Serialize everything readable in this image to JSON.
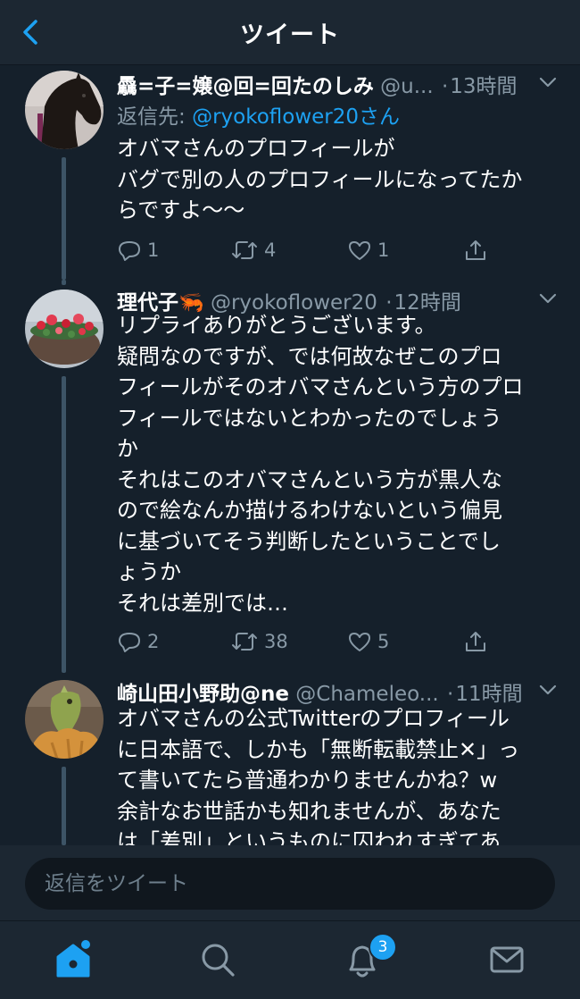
{
  "header": {
    "title": "ツイート",
    "back_icon": "chevron-left-icon"
  },
  "tweets": [
    {
      "name": "驫=子=嬢@回=回たのしみ",
      "handle": "@u...",
      "time": "13時間",
      "replying_prefix": "返信先: ",
      "replying_to": "@ryokoflower20さん",
      "text": "オバマさんのプロフィールが\nバグで別の人のプロフィールになってたか\nらですよ〜〜",
      "replies": "1",
      "retweets": "4",
      "likes": "1"
    },
    {
      "name": "理代子",
      "name_emoji": "🦐",
      "handle": "@ryokoflower20",
      "time": "12時間",
      "text": "リプライありがとうございます。\n疑問なのですが、では何故なぜこのプロ\nフィールがそのオバマさんという方のプロ\nフィールではないとわかったのでしょう\nか\nそれはこのオバマさんという方が黒人な\nので絵なんか描けるわけないという偏見\nに基づいてそう判断したということでし\nょうか\nそれは差別では…",
      "replies": "2",
      "retweets": "38",
      "likes": "5"
    },
    {
      "name": "崎山田小野助@ne",
      "handle": "@Chameleo...",
      "time": "11時間",
      "text": "オバマさんの公式Twitterのプロフィール\nに日本語で、しかも「無断転載禁止✕」っ\nて書いてたら普通わかりませんかね？w\n余計なお世話かも知れませんが、あなた\nは「差別」というものに囚われすぎてあ"
    }
  ],
  "reply_bar": {
    "placeholder": "返信をツイート"
  },
  "tabbar": {
    "items": [
      "home-icon",
      "search-icon",
      "notifications-icon",
      "messages-icon"
    ],
    "notification_badge": "3"
  },
  "colors": {
    "background": "#15202b",
    "bar": "#1c2732",
    "accent": "#1da1f2",
    "secondary_text": "#8899a6"
  }
}
